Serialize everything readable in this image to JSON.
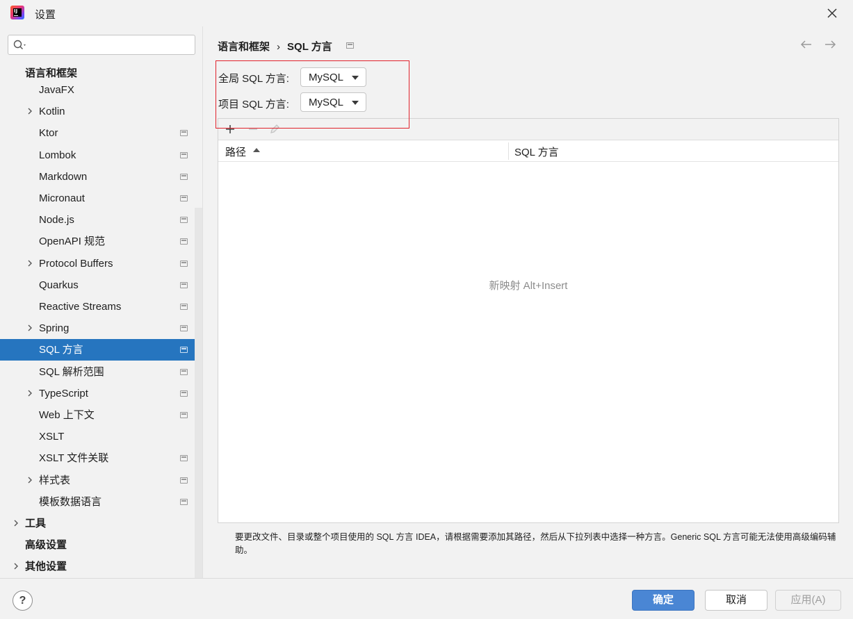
{
  "window": {
    "title": "设置"
  },
  "search": {
    "placeholder": "",
    "value": ""
  },
  "tree": {
    "group_label": "语言和框架",
    "items": [
      {
        "label": "JavaFX",
        "expandable": false,
        "project_icon": false,
        "selected": false
      },
      {
        "label": "Kotlin",
        "expandable": true,
        "project_icon": false,
        "selected": false
      },
      {
        "label": "Ktor",
        "expandable": false,
        "project_icon": true,
        "selected": false
      },
      {
        "label": "Lombok",
        "expandable": false,
        "project_icon": true,
        "selected": false
      },
      {
        "label": "Markdown",
        "expandable": false,
        "project_icon": true,
        "selected": false
      },
      {
        "label": "Micronaut",
        "expandable": false,
        "project_icon": true,
        "selected": false
      },
      {
        "label": "Node.js",
        "expandable": false,
        "project_icon": true,
        "selected": false
      },
      {
        "label": "OpenAPI 规范",
        "expandable": false,
        "project_icon": true,
        "selected": false
      },
      {
        "label": "Protocol Buffers",
        "expandable": true,
        "project_icon": true,
        "selected": false
      },
      {
        "label": "Quarkus",
        "expandable": false,
        "project_icon": true,
        "selected": false
      },
      {
        "label": "Reactive Streams",
        "expandable": false,
        "project_icon": true,
        "selected": false
      },
      {
        "label": "Spring",
        "expandable": true,
        "project_icon": true,
        "selected": false
      },
      {
        "label": "SQL 方言",
        "expandable": false,
        "project_icon": true,
        "selected": true
      },
      {
        "label": "SQL 解析范围",
        "expandable": false,
        "project_icon": true,
        "selected": false
      },
      {
        "label": "TypeScript",
        "expandable": true,
        "project_icon": true,
        "selected": false
      },
      {
        "label": "Web 上下文",
        "expandable": false,
        "project_icon": true,
        "selected": false
      },
      {
        "label": "XSLT",
        "expandable": false,
        "project_icon": false,
        "selected": false
      },
      {
        "label": "XSLT 文件关联",
        "expandable": false,
        "project_icon": true,
        "selected": false
      },
      {
        "label": "样式表",
        "expandable": true,
        "project_icon": true,
        "selected": false
      },
      {
        "label": "模板数据语言",
        "expandable": false,
        "project_icon": true,
        "selected": false
      }
    ],
    "top_level": [
      {
        "label": "工具",
        "expandable": true
      },
      {
        "label": "高级设置",
        "expandable": false
      },
      {
        "label": "其他设置",
        "expandable": true
      }
    ]
  },
  "breadcrumb": {
    "parent": "语言和框架",
    "separator": "›",
    "current": "SQL 方言"
  },
  "form": {
    "global_label": "全局 SQL 方言:",
    "global_value": "MySQL",
    "project_label": "项目 SQL 方言:",
    "project_value": "MySQL"
  },
  "table": {
    "col_path": "路径",
    "col_dialect": "SQL 方言",
    "empty_text": "新映射 Alt+Insert"
  },
  "hint": "要更改文件、目录或整个项目使用的 SQL 方言 IDEA，请根据需要添加其路径，然后从下拉列表中选择一种方言。Generic SQL 方言可能无法使用高级编码辅助。",
  "footer": {
    "help": "?",
    "ok": "确定",
    "cancel": "取消",
    "apply": "应用(A)"
  },
  "colors": {
    "selection": "#2675bf",
    "primary_button": "#4a86d4",
    "highlight_box": "#e0212b"
  }
}
